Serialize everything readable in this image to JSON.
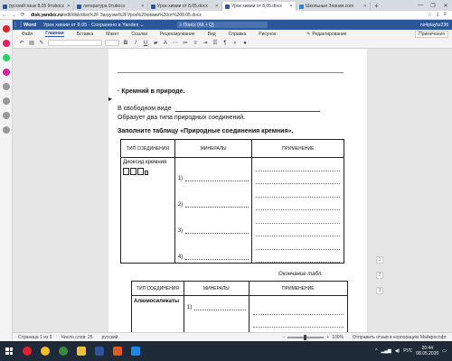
{
  "browser": {
    "tabs": [
      {
        "label": "русский язык 8,05 9тubocx",
        "color": "#2b579a",
        "active": false
      },
      {
        "label": "литература 9тubocx",
        "color": "#2b579a",
        "active": false
      },
      {
        "label": "Урок химии от 8,05.docx",
        "color": "#2b579a",
        "active": false
      },
      {
        "label": "Урок химии от 8,05.docx",
        "color": "#2b579a",
        "active": true
      },
      {
        "label": "Школьные Знания.com",
        "color": "#1e88e5",
        "active": false
      }
    ],
    "new_tab": "+",
    "url_host": "disk.yandex.ru",
    "url_path": "/edit/disk/disk%2F Загрузки%2FУрок%20химии%20от%208.05.docx",
    "window_controls": [
      "—",
      "❐",
      "✕"
    ]
  },
  "word": {
    "app_name": "Word",
    "doc_title": "Урок химии от 8.05  ·  Сохранено в Yandex ⌄",
    "search_placeholder": "Поиск (Alt + Q)",
    "user": "nir4playhz238"
  },
  "ribbon": {
    "tabs": [
      "Файл",
      "Главная",
      "Вставка",
      "Макет",
      "Ссылки",
      "Рецензирование",
      "Вид",
      "Справка",
      "Рисунок"
    ],
    "active_tab": "Главная",
    "edit_mode": "Редактирование",
    "comments": "Примечания"
  },
  "document": {
    "side_mark": "▸",
    "heading": "Кремний в природе.",
    "heading_bullet": "·",
    "free_state": "В свободном виде",
    "forms_text": "Образует два типа природных соединений.",
    "task": "Заполните таблицу «Природные соединения кремния».",
    "table1": {
      "headers": [
        "ТИП СОЕДИНЕНИЯ",
        "МИНЕРАЛЫ",
        "ПРИМЕНЕНИЕ"
      ],
      "type_cell": "Диоксид кремния",
      "minerals": [
        "1)",
        "2)",
        "3)",
        "4)"
      ]
    },
    "end_note": "Окончание табл.",
    "table2": {
      "headers": [
        "ТИП СОЕДИНЕНИЯ",
        "МИНЕРАЛЫ",
        "ПРИМЕНЕНИЕ"
      ],
      "type_cell": "Алюмосиликаты",
      "minerals": [
        "1)"
      ]
    }
  },
  "status": {
    "page": "Страница 1 из 5",
    "words": "Число слов: 25",
    "lang": "русский",
    "zoom": "100%",
    "feedback": "Отправить отзыв в корпорацию Майкрософт"
  },
  "side_widgets": [
    "1",
    "2",
    "3"
  ],
  "taskbar": {
    "time": "20:44",
    "date": "08.05.2020",
    "apps": [
      {
        "name": "opera",
        "color": "#e0202a"
      },
      {
        "name": "yandex",
        "color": "#f0c020"
      },
      {
        "name": "chrome",
        "color": "#3b8a3e"
      },
      {
        "name": "explorer",
        "color": "#f0c040"
      },
      {
        "name": "word",
        "color": "#2b579a"
      },
      {
        "name": "media",
        "color": "#e05a1a"
      },
      {
        "name": "store",
        "color": "#1e88e5"
      }
    ],
    "lang": "РУС"
  }
}
